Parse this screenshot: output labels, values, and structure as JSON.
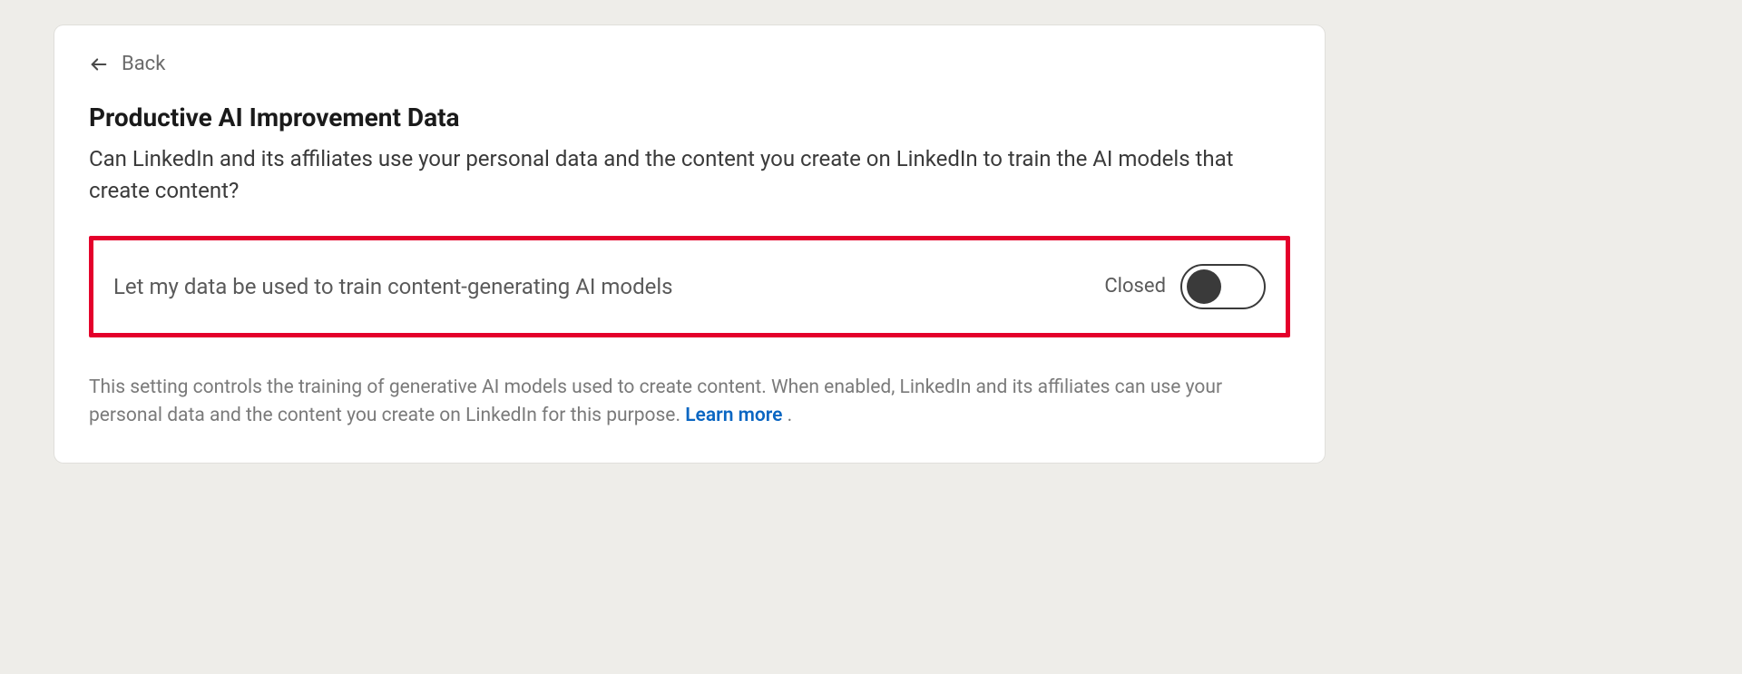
{
  "back": {
    "label": "Back"
  },
  "page": {
    "title": "Productive AI Improvement Data",
    "description": "Can LinkedIn and its affiliates use your personal data and the content you create on LinkedIn to train the AI models that create content?"
  },
  "setting": {
    "label": "Let my data be used to train content-generating AI models",
    "status": "Closed"
  },
  "footer": {
    "text_before": "This setting controls the training of generative AI models used to create content. When enabled, LinkedIn and its affiliates can use your personal data and the content you create on LinkedIn for this purpose. ",
    "learn_more": "Learn more",
    "text_after": " ."
  }
}
